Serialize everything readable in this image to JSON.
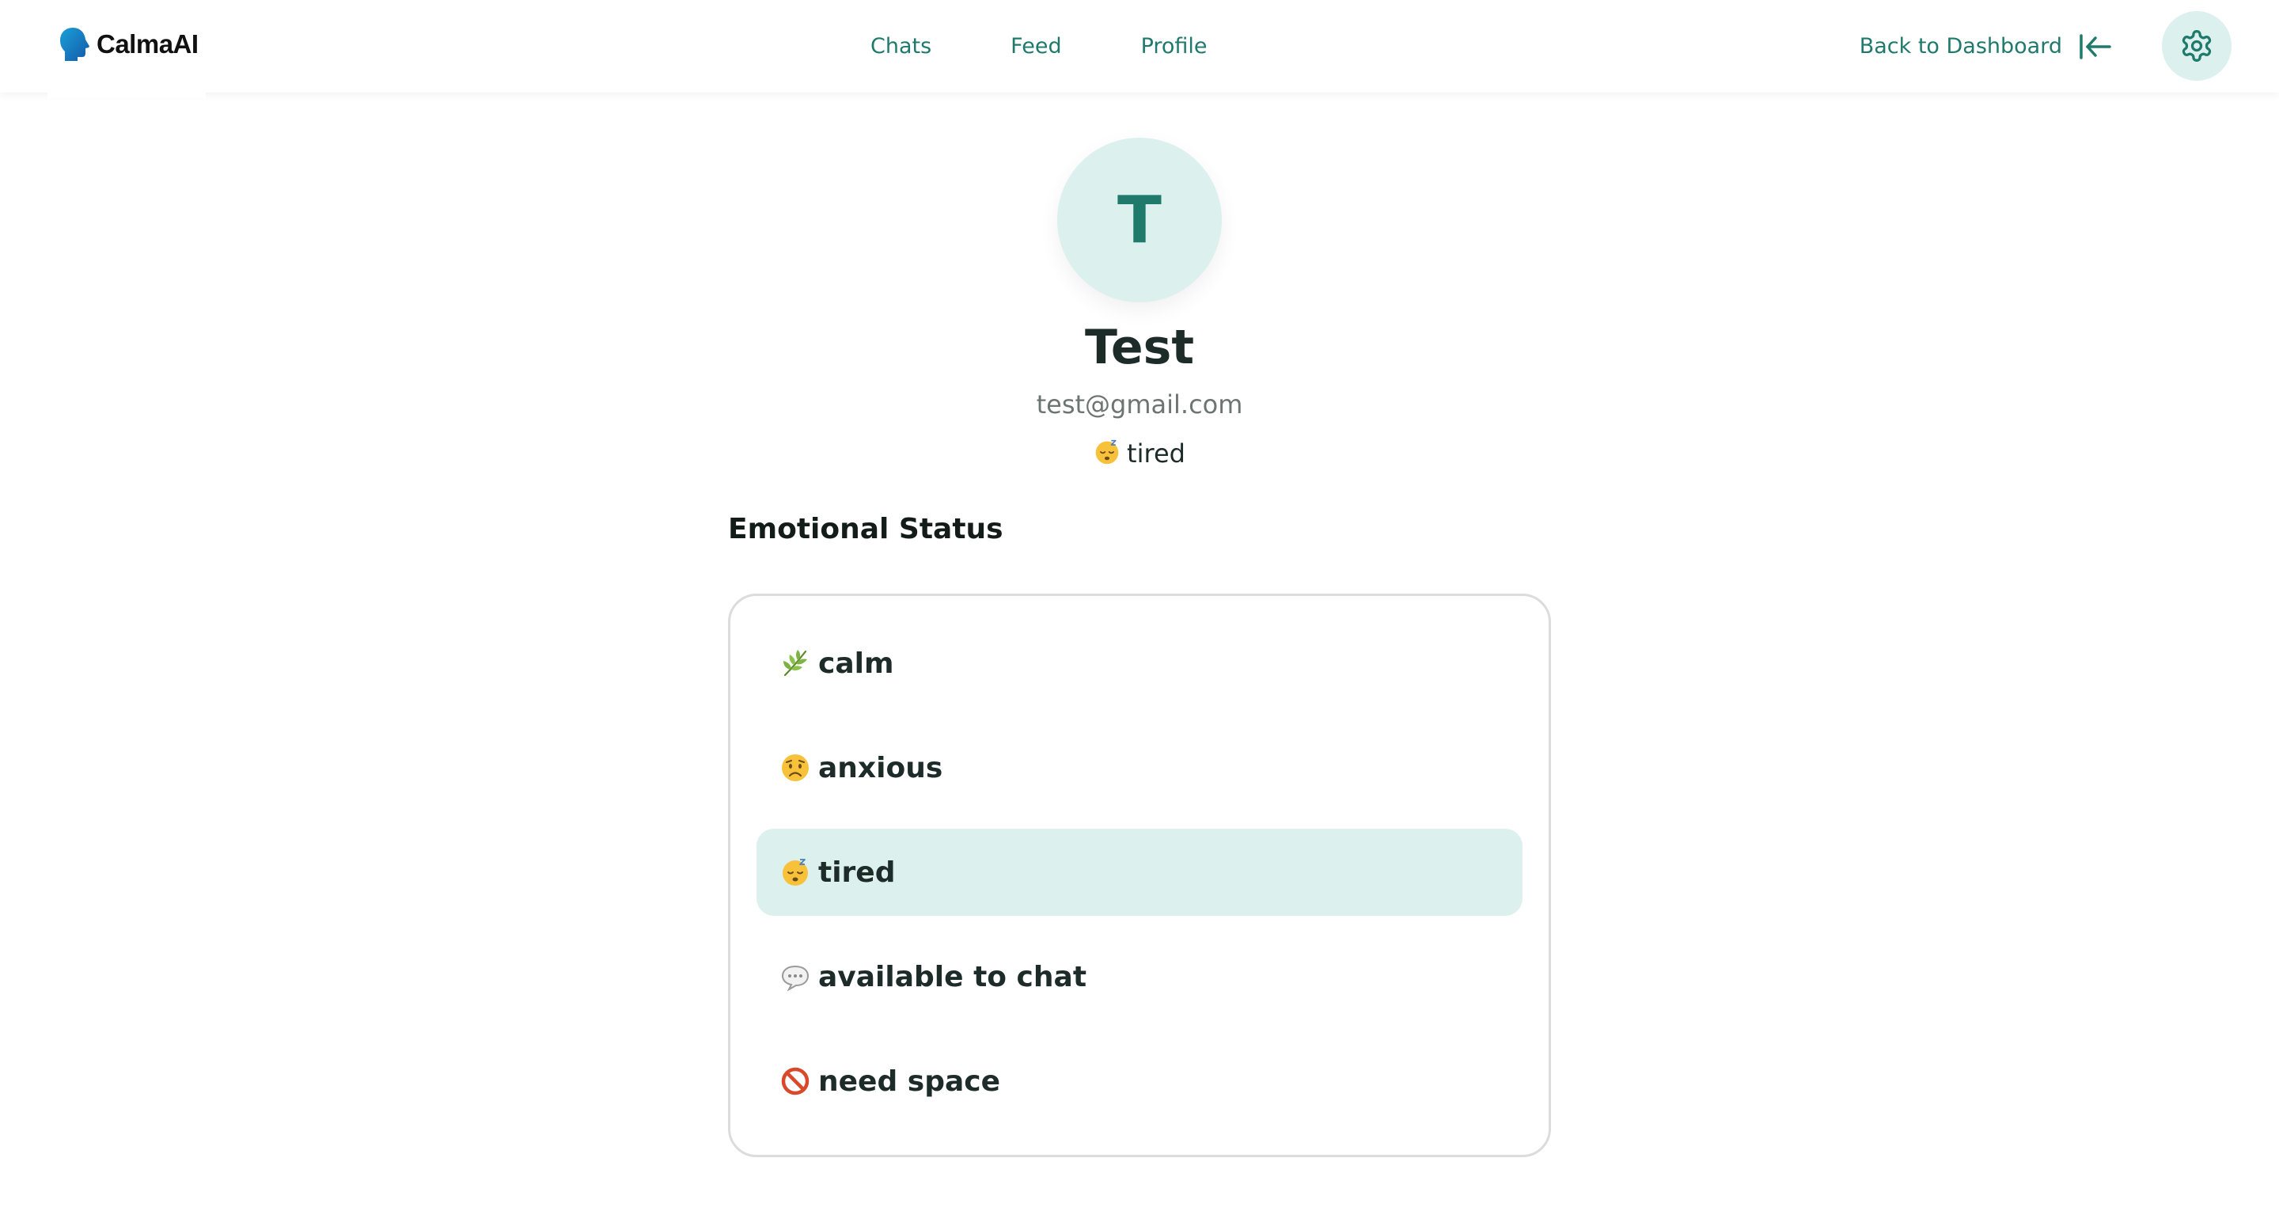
{
  "brand": {
    "name": "CalmaAI"
  },
  "nav": {
    "links": [
      {
        "label": "Chats"
      },
      {
        "label": "Feed"
      },
      {
        "label": "Profile"
      }
    ],
    "back_label": "Back to Dashboard"
  },
  "icons": {
    "logo": "head-silhouette-icon",
    "back": "arrow-left-to-line-icon",
    "settings": "gear-icon",
    "calm": "herb-leaf-icon",
    "anxious": "worried-face-icon",
    "tired": "sleeping-face-icon",
    "available": "speech-bubble-icon",
    "need_space": "prohibited-icon"
  },
  "profile": {
    "avatar_letter": "T",
    "name": "Test",
    "email": "test@gmail.com",
    "current_status": "tired"
  },
  "emotional_status": {
    "title": "Emotional Status",
    "selected": "tired",
    "options": [
      {
        "label": "calm"
      },
      {
        "label": "anxious"
      },
      {
        "label": "tired"
      },
      {
        "label": "available to chat"
      },
      {
        "label": "need space"
      }
    ]
  },
  "colors": {
    "accent": "#1f7a6c",
    "accent_light": "#dcf0ee",
    "text": "#1d2b29",
    "muted": "#6d7572",
    "border": "#dcdcdc"
  }
}
